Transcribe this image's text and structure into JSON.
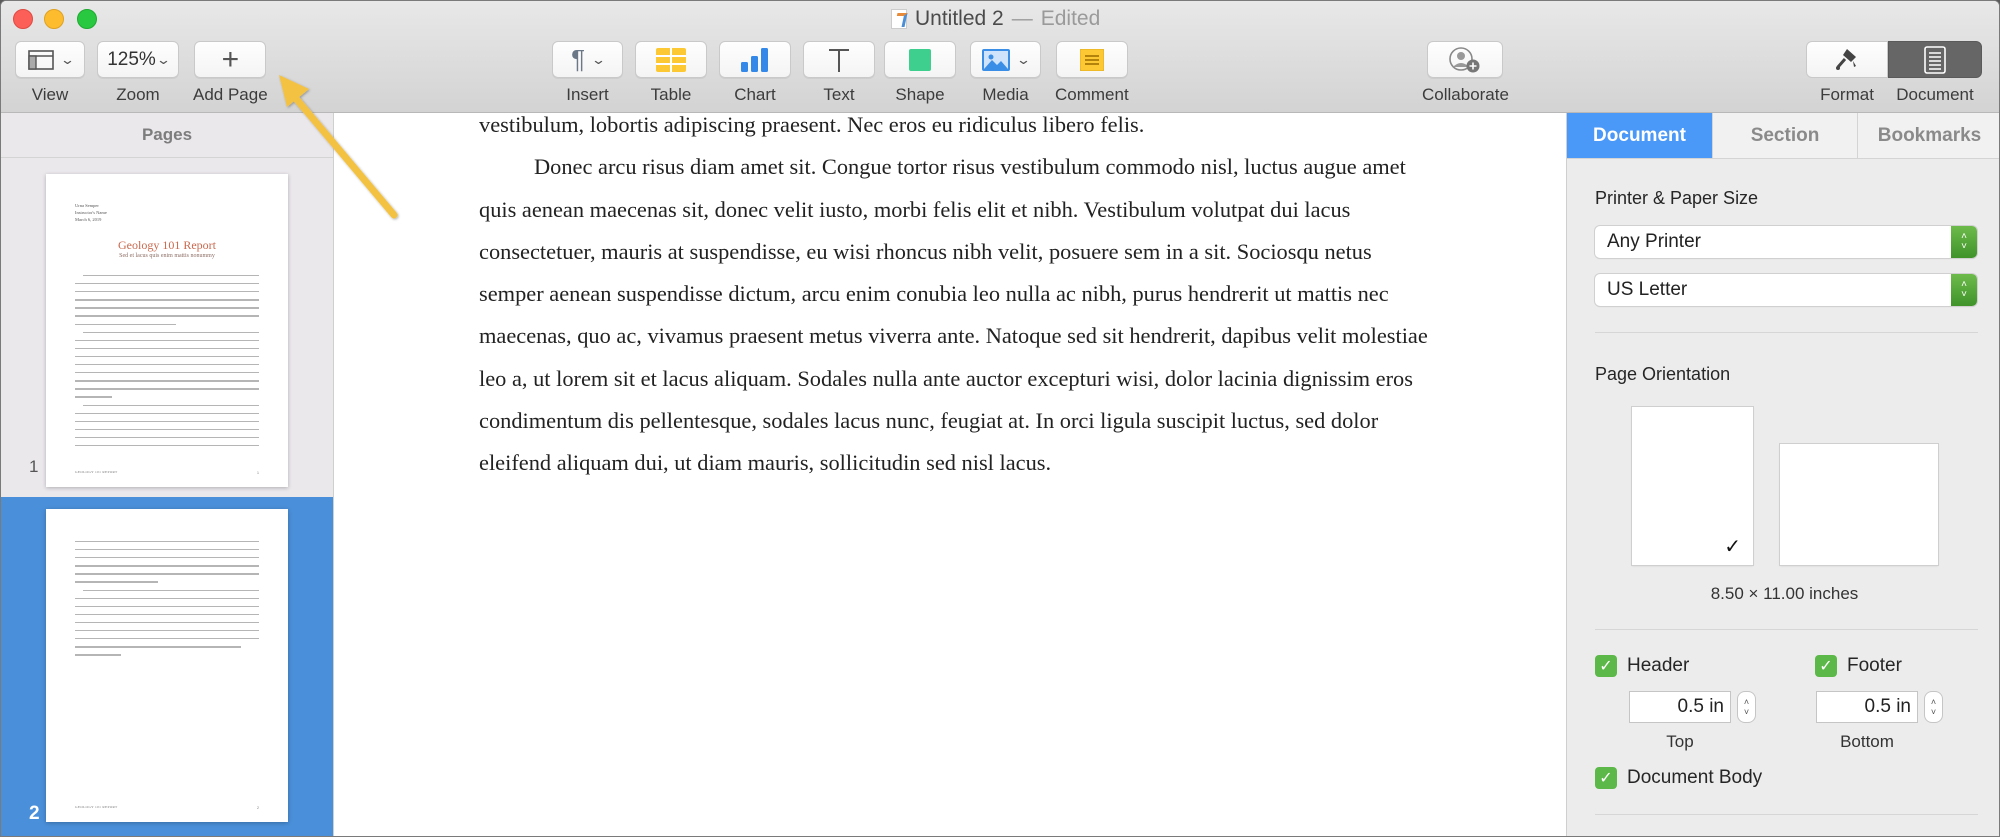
{
  "window": {
    "title": "Untitled 2",
    "title_separator": "—",
    "status": "Edited"
  },
  "toolbar": {
    "view": {
      "label": "View",
      "icon": "sidebar-layout-icon"
    },
    "zoom": {
      "label": "Zoom",
      "value": "125%"
    },
    "add_page": {
      "label": "Add Page",
      "icon": "plus-icon",
      "glyph": "+"
    },
    "insert": {
      "label": "Insert",
      "icon": "pilcrow-icon",
      "glyph": "¶"
    },
    "table": {
      "label": "Table",
      "icon": "table-icon"
    },
    "chart": {
      "label": "Chart",
      "icon": "bar-chart-icon"
    },
    "text": {
      "label": "Text",
      "icon": "text-box-icon",
      "glyph": "T"
    },
    "shape": {
      "label": "Shape",
      "icon": "shape-icon"
    },
    "media": {
      "label": "Media",
      "icon": "image-icon"
    },
    "comment": {
      "label": "Comment",
      "icon": "comment-note-icon"
    },
    "collaborate": {
      "label": "Collaborate",
      "icon": "add-person-icon"
    },
    "format": {
      "label": "Format",
      "icon": "paintbrush-icon"
    },
    "document": {
      "label": "Document",
      "icon": "document-icon",
      "active": true
    },
    "chevron": "⌄"
  },
  "sidebar": {
    "heading": "Pages",
    "pages": [
      {
        "number": "1",
        "selected": false,
        "author": "Urna Semper",
        "instructor": "Instructor's Name",
        "date": "March 6, 2019",
        "title": "Geology 101 Report",
        "subtitle": "Sed et lacus quis enim mattis nonummy",
        "footer": "GEOLOGY 101 REPORT",
        "page_no": "1"
      },
      {
        "number": "2",
        "selected": true,
        "footer": "GEOLOGY 101 REPORT",
        "page_no": "2"
      }
    ]
  },
  "document": {
    "paragraphs": [
      "vestibulum, lobortis adipiscing praesent. Nec eros eu ridiculus libero felis.",
      "Donec arcu risus diam amet sit. Congue tortor risus vestibulum commodo nisl, luctus augue amet quis aenean maecenas sit, donec velit iusto, morbi felis elit et nibh. Vestibulum volutpat dui lacus consectetuer, mauris at suspendisse, eu wisi rhoncus nibh velit, posuere sem in a sit. Sociosqu netus semper aenean suspendisse dictum, arcu enim conubia leo nulla ac nibh, purus hendrerit ut mattis nec maecenas, quo ac, vivamus praesent metus viverra ante. Natoque sed sit hendrerit, dapibus velit molestiae leo a, ut lorem sit et lacus aliquam. Sodales nulla ante auctor excepturi wisi, dolor lacinia dignissim eros condimentum dis pellentesque, sodales lacus nunc, feugiat at. In orci ligula suscipit luctus, sed dolor eleifend aliquam dui, ut diam mauris, sollicitudin sed nisl lacus."
    ]
  },
  "inspector": {
    "tabs": [
      {
        "label": "Document",
        "active": true
      },
      {
        "label": "Section",
        "active": false
      },
      {
        "label": "Bookmarks",
        "active": false
      }
    ],
    "printer_paper": {
      "heading": "Printer & Paper Size",
      "printer": "Any Printer",
      "paper": "US Letter"
    },
    "orientation": {
      "heading": "Page Orientation",
      "selected": "portrait",
      "check_glyph": "✓",
      "dimensions": "8.50 × 11.00 inches"
    },
    "header": {
      "label": "Header",
      "checked": true,
      "value": "0.5 in",
      "position_label": "Top"
    },
    "footer": {
      "label": "Footer",
      "checked": true,
      "value": "0.5 in",
      "position_label": "Bottom"
    },
    "document_body": {
      "label": "Document Body",
      "checked": true
    },
    "check_glyph": "✓"
  },
  "annotation": {
    "type": "arrow",
    "color": "#f4c242",
    "points_to": "add-page-button"
  }
}
